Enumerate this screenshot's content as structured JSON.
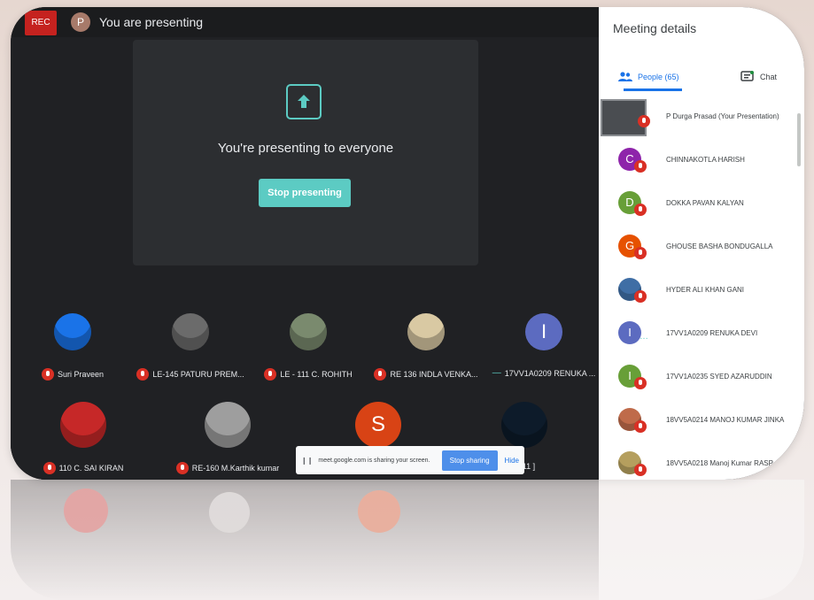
{
  "topbar": {
    "rec_label": "REC",
    "self_initial": "P",
    "presenting_label": "You are presenting"
  },
  "presentation": {
    "title": "You're presenting to everyone",
    "stop_label": "Stop presenting"
  },
  "tiles": [
    {
      "name": "Suri Praveen",
      "photo": true,
      "color": "#1a73e8",
      "mic": "muted"
    },
    {
      "name": "LE-145 PATURU PREM...",
      "photo": true,
      "color": "#6b6b6b",
      "mic": "muted"
    },
    {
      "name": "LE - 111 C. ROHITH",
      "photo": true,
      "color": "#7a8a6e",
      "mic": "muted"
    },
    {
      "name": "RE 136 INDLA VENKA...",
      "photo": true,
      "color": "#d9c9a3",
      "mic": "muted"
    },
    {
      "name": "17VV1A0209 RENUKA ...",
      "initial": "I",
      "color": "#5c6bc0",
      "mic": "speaking"
    },
    {
      "name": "110 C. SAI KIRAN",
      "photo": true,
      "color": "#c62828",
      "mic": "muted"
    },
    {
      "name": "RE-160 M.Karthik kumar",
      "photo": true,
      "color": "#9e9e9e",
      "mic": "muted"
    },
    {
      "name": "",
      "initial": "S",
      "color": "#d84315",
      "mic": "none"
    },
    {
      "name": "- 111 ]",
      "photo": true,
      "color": "#0d1b2a",
      "mic": "none"
    }
  ],
  "share_bar": {
    "text": "meet.google.com is sharing your screen.",
    "stop_label": "Stop sharing",
    "hide_label": "Hide"
  },
  "panel": {
    "title": "Meeting details",
    "tab_people": "People (65)",
    "tab_chat": "Chat",
    "participants": [
      {
        "name": "P Durga Prasad (Your Presentation)",
        "self": true,
        "color": "#4a4d51"
      },
      {
        "name": "CHINNAKOTLA HARISH",
        "initial": "C",
        "color": "#8e24aa"
      },
      {
        "name": "DOKKA PAVAN KALYAN",
        "initial": "D",
        "color": "#689f38"
      },
      {
        "name": "GHOUSE BASHA BONDUGALLA",
        "initial": "G",
        "color": "#e65100"
      },
      {
        "name": "HYDER ALI KHAN GANI",
        "photo": true,
        "color": "#3f6ea5"
      },
      {
        "name": "17VV1A0209 RENUKA DEVI",
        "initial": "I",
        "color": "#5c6bc0",
        "speaking": true
      },
      {
        "name": "17VV1A0235 SYED AZARUDDIN",
        "initial": "I",
        "color": "#689f38"
      },
      {
        "name": "18VV5A0214 MANOJ KUMAR JINKA",
        "photo": true,
        "color": "#bf6b4a"
      },
      {
        "name": "18VV5A0218 Manoj Kumar RASP...",
        "photo": true,
        "color": "#b59f5e"
      }
    ]
  }
}
